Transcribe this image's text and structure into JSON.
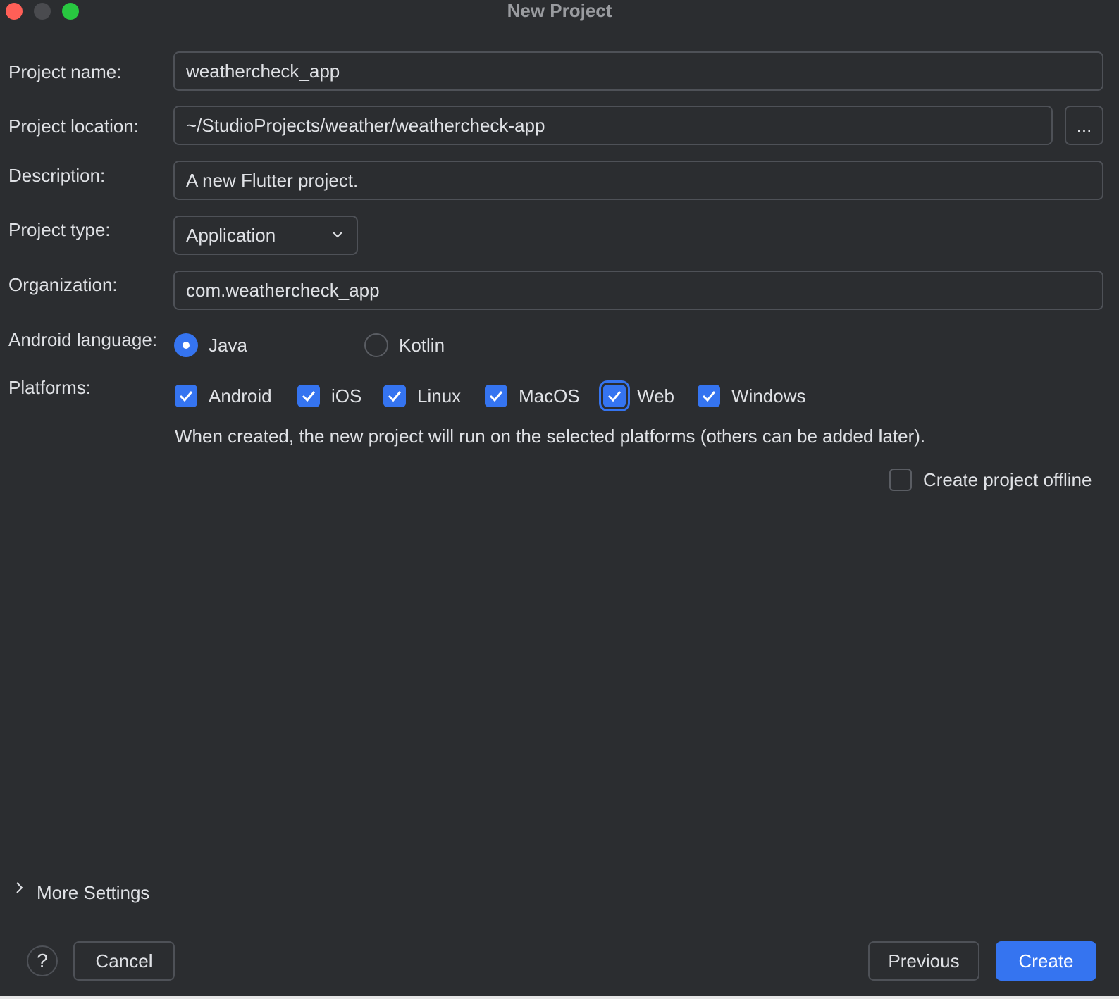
{
  "window": {
    "title": "New Project"
  },
  "form": {
    "project_name": {
      "label": "Project name:",
      "value": "weathercheck_app"
    },
    "project_location": {
      "label": "Project location:",
      "value": "~/StudioProjects/weather/weathercheck-app",
      "browse_label": "..."
    },
    "description": {
      "label": "Description:",
      "value": "A new Flutter project."
    },
    "project_type": {
      "label": "Project type:",
      "value": "Application"
    },
    "organization": {
      "label": "Organization:",
      "value": "com.weathercheck_app"
    },
    "android_language": {
      "label": "Android language:",
      "options": [
        {
          "label": "Java",
          "selected": true
        },
        {
          "label": "Kotlin",
          "selected": false
        }
      ]
    },
    "platforms": {
      "label": "Platforms:",
      "items": [
        {
          "label": "Android",
          "checked": true
        },
        {
          "label": "iOS",
          "checked": true
        },
        {
          "label": "Linux",
          "checked": true
        },
        {
          "label": "MacOS",
          "checked": true
        },
        {
          "label": "Web",
          "checked": true
        },
        {
          "label": "Windows",
          "checked": true
        }
      ],
      "hint": "When created, the new project will run on the selected platforms (others can be added later)."
    },
    "offline": {
      "label": "Create project offline",
      "checked": false
    }
  },
  "more_settings": {
    "label": "More Settings"
  },
  "footer": {
    "help_label": "?",
    "cancel_label": "Cancel",
    "previous_label": "Previous",
    "create_label": "Create"
  },
  "colors": {
    "background": "#2b2d30",
    "accent": "#3574f0",
    "border": "#4e5157",
    "text": "#dfe1e5"
  }
}
